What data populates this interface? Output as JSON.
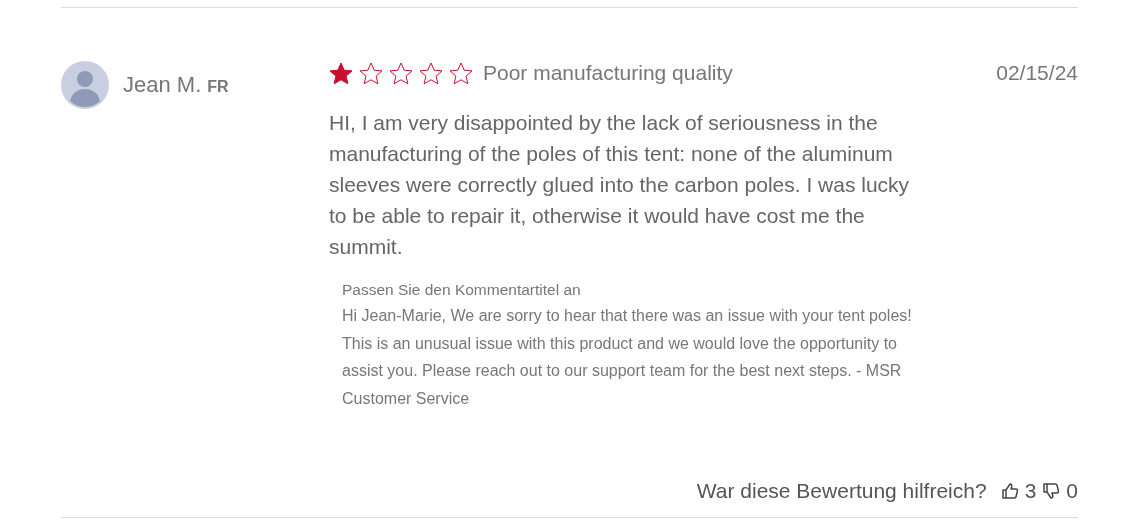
{
  "review": {
    "author": "Jean M.",
    "country": "FR",
    "stars": 1,
    "title": "Poor manufacturing quality",
    "date": "02/15/24",
    "body": "HI, I am very disappointed by the lack of seriousness in the manufacturing of the poles of this tent: none of the aluminum sleeves were correctly glued into the carbon poles. I was lucky to be able to repair it, otherwise it would have cost me the summit.",
    "response": {
      "title": "Passen Sie den Kommentartitel an",
      "text": "Hi Jean-Marie, We are sorry to hear that there was an issue with your tent poles! This is an unusual issue with this product and we would love the opportunity to assist you. Please reach out to our support team for the best next steps. - MSR Customer Service"
    },
    "helpful": {
      "question": "War diese Bewertung hilfreich?",
      "up_count": "3",
      "down_count": "0"
    }
  }
}
